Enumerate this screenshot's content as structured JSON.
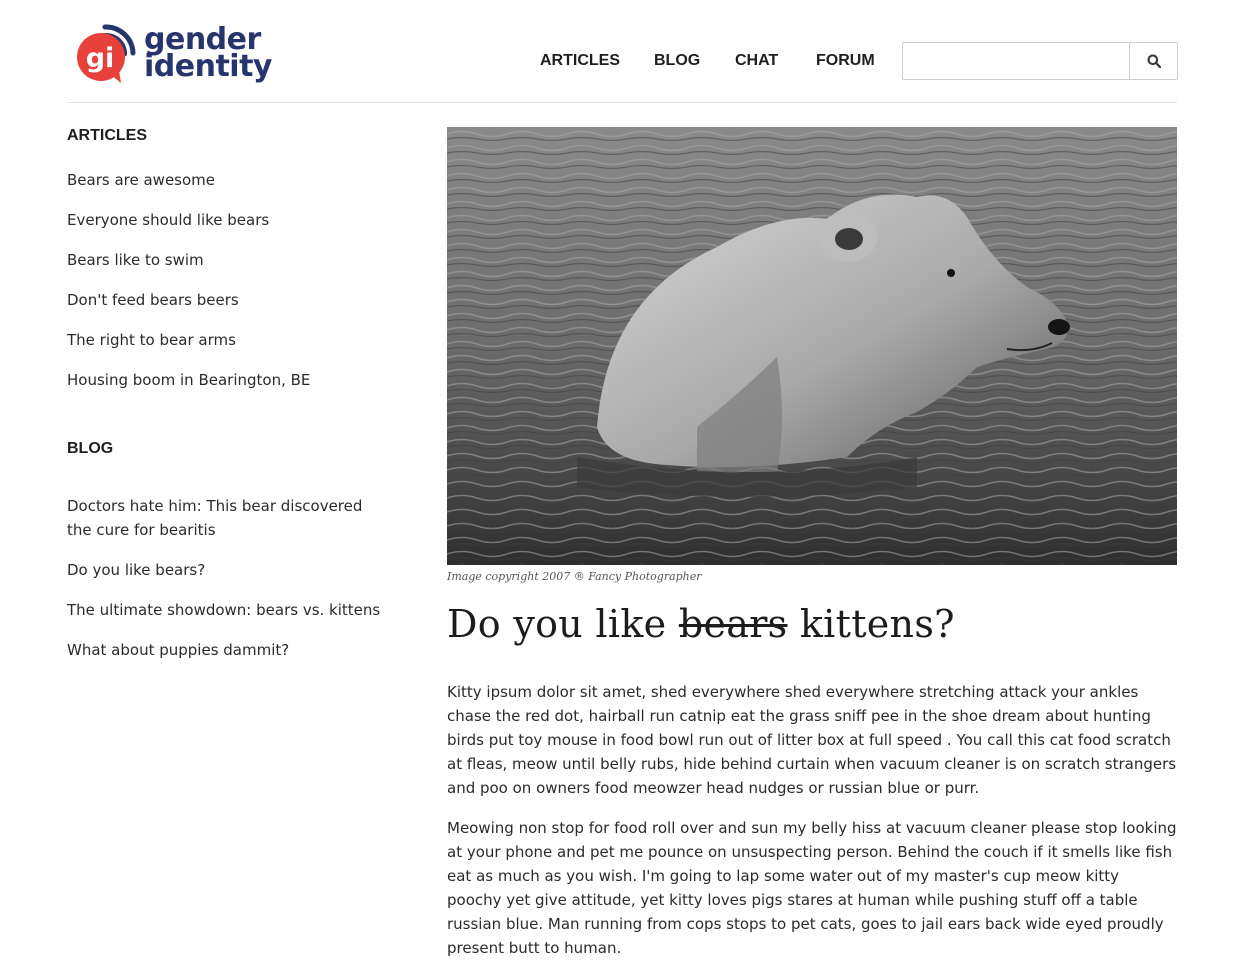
{
  "header": {
    "logo": {
      "mark": "gi",
      "line1": "gender",
      "line2": "identity",
      "colors": {
        "mark": "#e8413b",
        "arc": "#27356e",
        "text": "#27356e"
      }
    },
    "nav": [
      {
        "label": "ARTICLES"
      },
      {
        "label": "BLOG"
      },
      {
        "label": "CHAT"
      },
      {
        "label": "FORUM"
      }
    ],
    "search": {
      "value": "",
      "placeholder": "",
      "button_icon": "search-icon"
    }
  },
  "sidebar": {
    "articles": {
      "heading": "ARTICLES",
      "items": [
        "Bears are awesome",
        "Everyone should like bears",
        "Bears like to swim",
        "Don't feed bears beers",
        "The right to bear arms",
        "Housing boom in Bearington, BE"
      ]
    },
    "blog": {
      "heading": "BLOG",
      "items": [
        "Doctors hate him: This bear discovered the cure for bearitis",
        "Do you like bears?",
        "The ultimate showdown: bears vs. kittens",
        "What about puppies dammit?"
      ]
    }
  },
  "article": {
    "image": {
      "subject": "black-and-white photo of a bear wading in water"
    },
    "caption": "Image copyright 2007 ® Fancy Photographer",
    "title": {
      "before": "Do you like ",
      "struck": "bears",
      "after": " kittens?"
    },
    "paragraphs": [
      "Kitty ipsum dolor sit amet, shed everywhere shed everywhere stretching attack your ankles chase the red dot, hairball run catnip eat the grass sniff pee in the shoe dream about hunting birds put toy mouse in food bowl run out of litter box at full speed . You call this cat food scratch at fleas, meow until belly rubs, hide behind curtain when vacuum cleaner is on scratch strangers and poo on owners food meowzer head nudges or russian blue or purr.",
      "Meowing non stop for food roll over and sun my belly hiss at vacuum cleaner please stop looking at your phone and pet me pounce on unsuspecting person. Behind the couch if it smells like fish eat as much as you wish. I'm going to lap some water out of my master's cup meow kitty poochy yet give attitude, yet kitty loves pigs stares at human while pushing stuff off a table russian blue. Man running from cops stops to pet cats, goes to jail ears back wide eyed proudly present butt to human."
    ]
  }
}
